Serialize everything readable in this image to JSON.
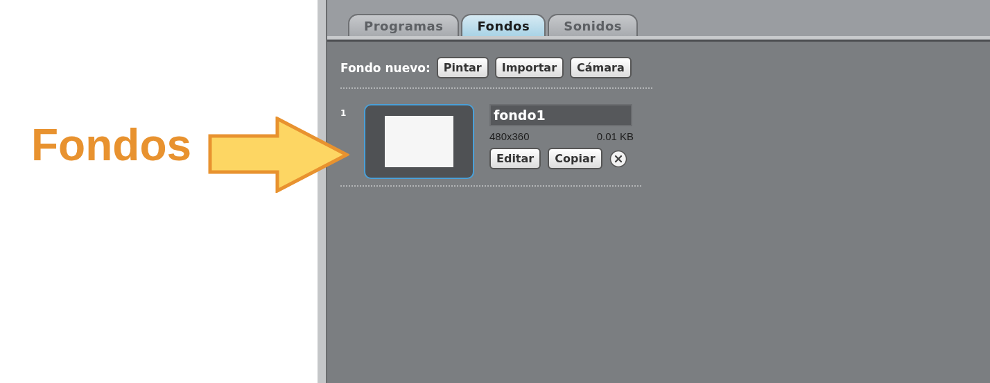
{
  "annotation": {
    "label": "Fondos"
  },
  "tabs": [
    {
      "label": "Programas",
      "selected": false
    },
    {
      "label": "Fondos",
      "selected": true
    },
    {
      "label": "Sonidos",
      "selected": false
    }
  ],
  "new_background": {
    "label": "Fondo nuevo:",
    "buttons": [
      "Pintar",
      "Importar",
      "Cámara"
    ]
  },
  "backgrounds": [
    {
      "number": "1",
      "selected": true,
      "name": "fondo1",
      "size": "480x360",
      "file_size": "0.01 KB",
      "buttons": [
        "Editar",
        "Copiar"
      ]
    }
  ]
}
